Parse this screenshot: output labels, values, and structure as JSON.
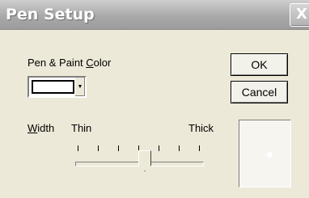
{
  "window": {
    "title": "Pen Setup",
    "close_glyph": "X"
  },
  "color": {
    "label_pre": "Pen & Paint ",
    "label_mnemonic": "C",
    "label_post": "olor",
    "value": "#ffffff",
    "arrow_glyph": "▼"
  },
  "buttons": {
    "ok": "OK",
    "cancel": "Cancel"
  },
  "width": {
    "label_mnemonic": "W",
    "label_post": "idth",
    "min_label": "Thin",
    "max_label": "Thick",
    "tick_count": 7,
    "position": 0.55
  },
  "preview": {
    "dot_color": "#ffffff"
  }
}
